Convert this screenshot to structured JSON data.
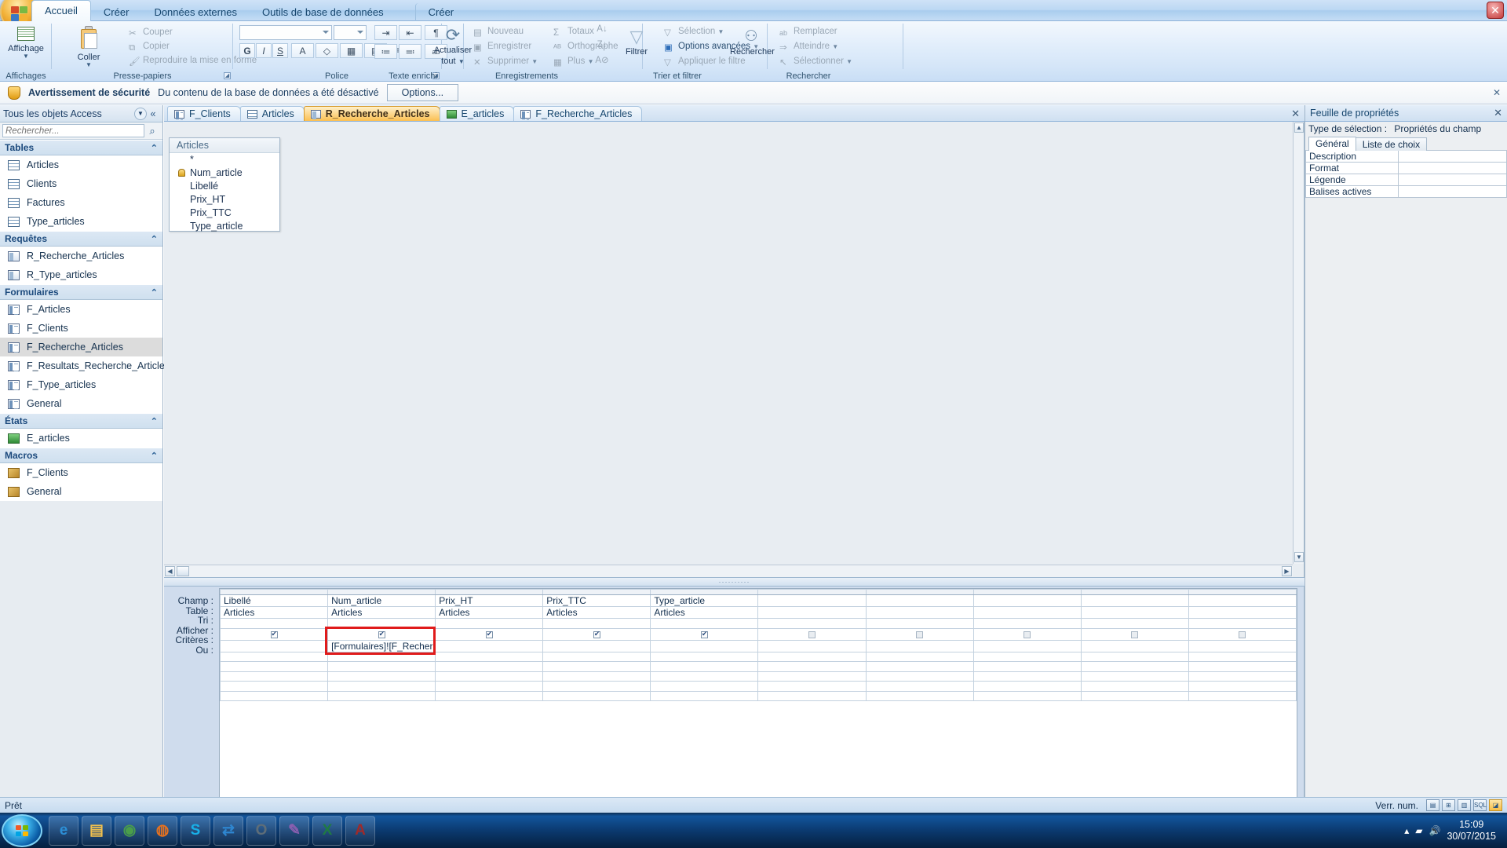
{
  "window": {
    "close_label": "✕"
  },
  "ribbon": {
    "tabs": [
      {
        "label": "Accueil",
        "active": true
      },
      {
        "label": "Créer",
        "active": false
      },
      {
        "label": "Données externes",
        "active": false
      },
      {
        "label": "Outils de base de données",
        "active": false
      },
      {
        "label": "Créer",
        "active": false
      }
    ],
    "groups": [
      {
        "name": "Affichages"
      },
      {
        "name": "Presse-papiers"
      },
      {
        "name": "Police"
      },
      {
        "name": "Texte enrichi"
      },
      {
        "name": "Enregistrements"
      },
      {
        "name": "Trier et filtrer"
      },
      {
        "name": "Rechercher"
      }
    ],
    "views": {
      "big_label": "Affichage",
      "arrow": "▼"
    },
    "clipboard": {
      "paste_label": "Coller",
      "paste_arrow": "▼",
      "cut_label": "Couper",
      "copy_label": "Copier",
      "format_painter_label": "Reproduire la mise en forme"
    },
    "font": {
      "font_name_value": "",
      "font_size_value": "",
      "bold": "G",
      "italic": "I",
      "underline": "S",
      "font_color": "A",
      "fill_color": "◇",
      "gridlines": "▦",
      "alt_fill": "▤",
      "align_left": "≡",
      "align_center": "≡",
      "align_right": "≡"
    },
    "rich_text": {
      "dec_indent": "⇥",
      "inc_indent": "⇤",
      "ltr": "¶",
      "numbering": "≔",
      "bullets": "≕",
      "text_dir": "ab"
    },
    "records": {
      "refresh_label": "Actualiser",
      "refresh_label2": "tout",
      "refresh_arrow": "▼",
      "new_label": "Nouveau",
      "save_label": "Enregistrer",
      "delete_label": "Supprimer",
      "delete_arrow": "▼",
      "totals_label": "Totaux",
      "spelling_label": "Orthographe",
      "more_label": "Plus",
      "more_arrow": "▼"
    },
    "sortfilter": {
      "sort_az": "A↓",
      "sort_za": "Z↓",
      "clear_sort": "A⊘",
      "filter_label": "Filtrer",
      "selection_label": "Sélection",
      "selection_arrow": "▼",
      "advanced_label": "Options avancées",
      "advanced_arrow": "▼",
      "apply_filter_label": "Appliquer le filtre"
    },
    "find": {
      "find_label": "Rechercher",
      "replace_label": "Remplacer",
      "goto_label": "Atteindre",
      "goto_arrow": "▼",
      "select_label": "Sélectionner",
      "select_arrow": "▼"
    }
  },
  "security_bar": {
    "title": "Avertissement de sécurité",
    "message": "Du contenu de la base de données a été désactivé",
    "options_button": "Options...",
    "close": "✕",
    "icon": "shield-icon"
  },
  "nav_pane": {
    "title": "Tous les objets Access",
    "dropdown_icon": "▼",
    "collapse_icon": "«",
    "search_placeholder": "Rechercher...",
    "search_value": "",
    "search_icon": "search-icon",
    "groups": [
      {
        "label": "Tables",
        "chevron": "⌃",
        "icon": "table-icon",
        "items": [
          {
            "label": "Articles",
            "selected": false
          },
          {
            "label": "Clients",
            "selected": false
          },
          {
            "label": "Factures",
            "selected": false
          },
          {
            "label": "Type_articles",
            "selected": false
          }
        ]
      },
      {
        "label": "Requêtes",
        "chevron": "⌃",
        "icon": "query-icon",
        "items": [
          {
            "label": "R_Recherche_Articles",
            "selected": false
          },
          {
            "label": "R_Type_articles",
            "selected": false
          }
        ]
      },
      {
        "label": "Formulaires",
        "chevron": "⌃",
        "icon": "form-icon",
        "items": [
          {
            "label": "F_Articles",
            "selected": false
          },
          {
            "label": "F_Clients",
            "selected": false
          },
          {
            "label": "F_Recherche_Articles",
            "selected": true
          },
          {
            "label": "F_Resultats_Recherche_Articles",
            "selected": false
          },
          {
            "label": "F_Type_articles",
            "selected": false
          },
          {
            "label": "General",
            "selected": false
          }
        ]
      },
      {
        "label": "États",
        "chevron": "⌃",
        "icon": "report-icon",
        "items": [
          {
            "label": "E_articles",
            "selected": false
          }
        ]
      },
      {
        "label": "Macros",
        "chevron": "⌃",
        "icon": "macro-icon",
        "items": [
          {
            "label": "F_Clients",
            "selected": false
          },
          {
            "label": "General",
            "selected": false
          }
        ]
      }
    ]
  },
  "doc_tabs": {
    "close_icon": "✕",
    "tabs": [
      {
        "label": "F_Clients",
        "icon": "form-icon",
        "active": false
      },
      {
        "label": "Articles",
        "icon": "table-icon",
        "active": false
      },
      {
        "label": "R_Recherche_Articles",
        "icon": "query-icon",
        "active": true
      },
      {
        "label": "E_articles",
        "icon": "report-icon",
        "active": false
      },
      {
        "label": "F_Recherche_Articles",
        "icon": "form-icon",
        "active": false
      }
    ]
  },
  "query_design": {
    "table_box": {
      "title": "Articles",
      "fields": [
        {
          "name": "*",
          "key": false
        },
        {
          "name": "Num_article",
          "key": true
        },
        {
          "name": "Libellé",
          "key": false
        },
        {
          "name": "Prix_HT",
          "key": false
        },
        {
          "name": "Prix_TTC",
          "key": false
        },
        {
          "name": "Type_article",
          "key": false
        }
      ]
    },
    "scroll": {
      "up": "▲",
      "down": "▼",
      "left": "◀",
      "right": "▶"
    },
    "splitter_dots": "··········",
    "grid": {
      "row_labels": [
        "Champ :",
        "Table :",
        "Tri :",
        "Afficher :",
        "Critères :",
        "Ou :"
      ],
      "columns": [
        {
          "field": "Libellé",
          "table": "Articles",
          "sort": "",
          "show": true,
          "criteria": "",
          "or": ""
        },
        {
          "field": "Num_article",
          "table": "Articles",
          "sort": "",
          "show": true,
          "criteria": "[Formulaires]![F_Recherche_Articles]![Liste_Articles]",
          "or": ""
        },
        {
          "field": "Prix_HT",
          "table": "Articles",
          "sort": "",
          "show": true,
          "criteria": "",
          "or": ""
        },
        {
          "field": "Prix_TTC",
          "table": "Articles",
          "sort": "",
          "show": true,
          "criteria": "",
          "or": ""
        },
        {
          "field": "Type_article",
          "table": "Articles",
          "sort": "",
          "show": true,
          "criteria": "",
          "or": ""
        },
        {
          "field": "",
          "table": "",
          "sort": "",
          "show": false,
          "criteria": "",
          "or": ""
        },
        {
          "field": "",
          "table": "",
          "sort": "",
          "show": false,
          "criteria": "",
          "or": ""
        },
        {
          "field": "",
          "table": "",
          "sort": "",
          "show": false,
          "criteria": "",
          "or": ""
        },
        {
          "field": "",
          "table": "",
          "sort": "",
          "show": false,
          "criteria": "",
          "or": ""
        },
        {
          "field": "",
          "table": "",
          "sort": "",
          "show": false,
          "criteria": "",
          "or": ""
        }
      ],
      "highlight_color": "#e01b1b",
      "highlight_column_index": 1
    }
  },
  "property_sheet": {
    "title": "Feuille de propriétés",
    "close_icon": "✕",
    "selection_type_label": "Type de sélection :",
    "selection_type_value": "Propriétés du champ",
    "tabs": [
      {
        "label": "Général",
        "active": true
      },
      {
        "label": "Liste de choix",
        "active": false
      }
    ],
    "properties": [
      {
        "key": "Description",
        "value": ""
      },
      {
        "key": "Format",
        "value": ""
      },
      {
        "key": "Légende",
        "value": ""
      },
      {
        "key": "Balises actives",
        "value": ""
      }
    ]
  },
  "status_bar": {
    "text": "Prêt",
    "numlock": "Verr. num.",
    "views": [
      {
        "icon": "datasheet-view-icon",
        "glyph": "▤",
        "active": false
      },
      {
        "icon": "pivottable-view-icon",
        "glyph": "⊞",
        "active": false
      },
      {
        "icon": "pivotchart-view-icon",
        "glyph": "▥",
        "active": false
      },
      {
        "icon": "sql-view-icon",
        "glyph": "SQL",
        "active": false
      },
      {
        "icon": "design-view-icon",
        "glyph": "◪",
        "active": true
      }
    ]
  },
  "taskbar": {
    "start_icon": "windows-start-icon",
    "items": [
      {
        "icon": "internet-explorer-icon",
        "glyph": "e",
        "color": "#2c8fd6"
      },
      {
        "icon": "file-explorer-icon",
        "glyph": "▤",
        "color": "#f2c14e"
      },
      {
        "icon": "chrome-icon",
        "glyph": "◉",
        "color": "#4a9e4a"
      },
      {
        "icon": "firefox-icon",
        "glyph": "◍",
        "color": "#e8721e"
      },
      {
        "icon": "skype-icon",
        "glyph": "S",
        "color": "#18b0e8"
      },
      {
        "icon": "sync-icon",
        "glyph": "⇄",
        "color": "#2e86d0"
      },
      {
        "icon": "opera-icon",
        "glyph": "O",
        "color": "#5e6d78"
      },
      {
        "icon": "paint-icon",
        "glyph": "✎",
        "color": "#8a5fb0"
      },
      {
        "icon": "excel-icon",
        "glyph": "X",
        "color": "#1f7a44"
      },
      {
        "icon": "access-icon",
        "glyph": "A",
        "color": "#9e2a2a"
      }
    ],
    "tray": {
      "show_desktop": "▴",
      "network_icon": "▰",
      "volume_icon": "🔊",
      "time": "15:09",
      "date": "30/07/2015"
    }
  }
}
